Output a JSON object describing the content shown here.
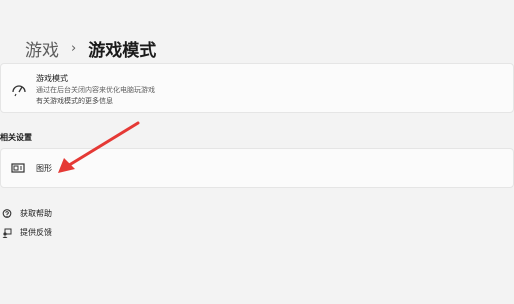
{
  "breadcrumb": {
    "parent": "游戏",
    "separator": "›",
    "current": "游戏模式"
  },
  "game_mode_card": {
    "icon": "gauge-icon",
    "title": "游戏模式",
    "description": "通过在后台关闭内容来优化电脑玩游戏",
    "link": "有关游戏模式的更多信息"
  },
  "related_settings": {
    "heading": "相关设置",
    "items": [
      {
        "icon": "graphics-icon",
        "label": "图形"
      }
    ]
  },
  "footer_links": {
    "help": {
      "icon": "help-icon",
      "label": "获取帮助"
    },
    "feedback": {
      "icon": "feedback-icon",
      "label": "提供反馈"
    }
  },
  "colors": {
    "background": "#f3f3f3",
    "card": "#fbfbfb",
    "annotation_arrow": "#e53935"
  }
}
